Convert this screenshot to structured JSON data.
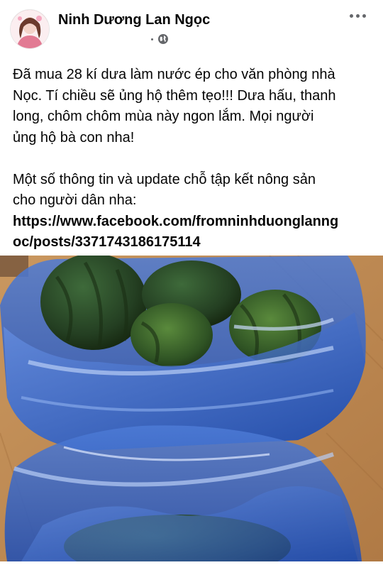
{
  "post": {
    "author": "Ninh Dương Lan Ngọc",
    "privacy_icon": "globe-icon",
    "menu_icon": "more-options-icon",
    "text_lines": [
      "Đã mua 28 kí dưa làm nước ép cho văn phòng nhà",
      "Nọc. Tí chiều sẽ ủng hộ thêm tẹo!!! Dưa hấu, thanh",
      "long, chôm chôm mùa này ngon lắm. Mọi người",
      "ủng hộ bà con nha!"
    ],
    "text_lines_2": [
      "Một số thông tin và update chỗ tập kết nông sản",
      "cho người dân nha:"
    ],
    "link_lines": [
      "https://www.facebook.com/fromninhduonglanng",
      "oc/posts/3371743186175114"
    ],
    "photo_icon": "watermelons-in-blue-bags-photo"
  }
}
